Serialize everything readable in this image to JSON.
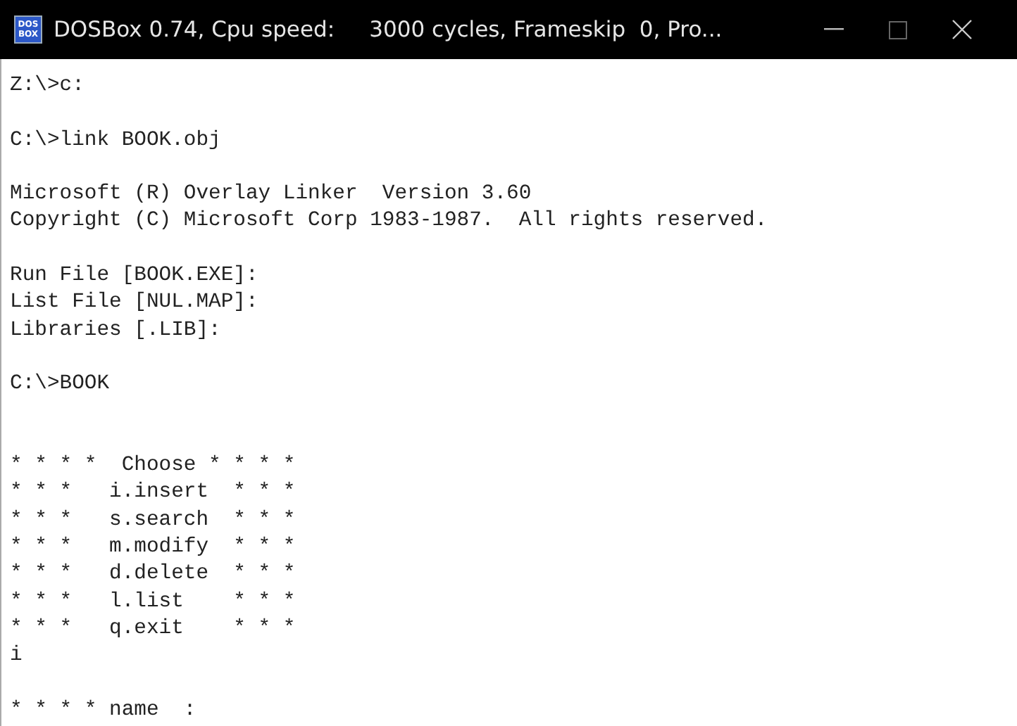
{
  "window": {
    "title": "DOSBox 0.74, Cpu speed:     3000 cycles, Frameskip  0, Pro...",
    "icon_text": [
      "DOS",
      "BOX"
    ]
  },
  "terminal": {
    "lines": [
      {
        "kind": "text",
        "text": "Z:\\>c:"
      },
      {
        "kind": "blank"
      },
      {
        "kind": "text",
        "text": "C:\\>link BOOK.obj"
      },
      {
        "kind": "blank"
      },
      {
        "kind": "text",
        "text": "Microsoft (R) Overlay Linker  Version 3.60"
      },
      {
        "kind": "text",
        "text": "Copyright (C) Microsoft Corp 1983-1987.  All rights reserved."
      },
      {
        "kind": "blank"
      },
      {
        "kind": "text",
        "text": "Run File [BOOK.EXE]:"
      },
      {
        "kind": "text",
        "text": "List File [NUL.MAP]:"
      },
      {
        "kind": "text",
        "text": "Libraries [.LIB]:"
      },
      {
        "kind": "blank"
      },
      {
        "kind": "text",
        "text": "C:\\>BOOK"
      },
      {
        "kind": "blank"
      },
      {
        "kind": "blank"
      },
      {
        "kind": "text",
        "text": "* * * *  Choose * * * *"
      },
      {
        "kind": "text",
        "text": "* * *   i.insert  * * *"
      },
      {
        "kind": "text",
        "text": "* * *   s.search  * * *"
      },
      {
        "kind": "text",
        "text": "* * *   m.modify  * * *"
      },
      {
        "kind": "text",
        "text": "* * *   d.delete  * * *"
      },
      {
        "kind": "text",
        "text": "* * *   l.list    * * *"
      },
      {
        "kind": "text",
        "text": "* * *   q.exit    * * *"
      },
      {
        "kind": "text",
        "text": "i"
      },
      {
        "kind": "blank"
      },
      {
        "kind": "text",
        "text": "* * * * name  :"
      }
    ]
  }
}
